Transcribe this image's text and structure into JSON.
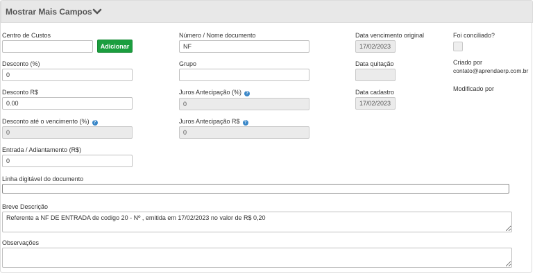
{
  "header": {
    "title": "Mostrar Mais Campos",
    "chevron_icon": "chevron-down-icon"
  },
  "fields": {
    "centro_custos": {
      "label": "Centro de Custos",
      "value": "",
      "button": "Adicionar"
    },
    "numero_documento": {
      "label": "Número / Nome documento",
      "value": "NF"
    },
    "data_vencimento_original": {
      "label": "Data vencimento original",
      "value": "17/02/2023"
    },
    "foi_conciliado": {
      "label": "Foi conciliado?",
      "checked": false
    },
    "desconto_pct": {
      "label": "Desconto (%)",
      "value": "0"
    },
    "grupo": {
      "label": "Grupo",
      "value": ""
    },
    "data_quitacao": {
      "label": "Data quitação",
      "value": ""
    },
    "criado_por": {
      "label": "Criado por",
      "value": "contato@aprendaerp.com.br"
    },
    "desconto_rs": {
      "label": "Desconto R$",
      "value": "0.00"
    },
    "juros_antecipacao_pct": {
      "label": "Juros Antecipação (%)",
      "value": "0"
    },
    "data_cadastro": {
      "label": "Data cadastro",
      "value": "17/02/2023"
    },
    "modificado_por": {
      "label": "Modificado por",
      "value": ""
    },
    "desconto_vencimento_pct": {
      "label": "Desconto até o vencimento (%)",
      "value": "0"
    },
    "juros_antecipacao_rs": {
      "label": "Juros Antecipação R$",
      "value": "0"
    },
    "entrada_adiantamento": {
      "label": "Entrada / Adiantamento (R$)",
      "value": "0"
    },
    "linha_digitavel": {
      "label": "Linha digitável do documento",
      "value": ""
    },
    "breve_descricao": {
      "label": "Breve Descrição",
      "value": "Referente a NF DE ENTRADA de codigo 20 - Nº , emitida em 17/02/2023 no valor de R$ 0,20"
    },
    "observacoes": {
      "label": "Observações",
      "value": ""
    }
  },
  "icons": {
    "help": "help-circle-icon",
    "resize": "resize-handle-icon"
  },
  "colors": {
    "header_bg": "#e8e8e8",
    "button_green": "#1b9e3e",
    "help_blue": "#3a87c8",
    "readonly_bg": "#ebebeb"
  }
}
